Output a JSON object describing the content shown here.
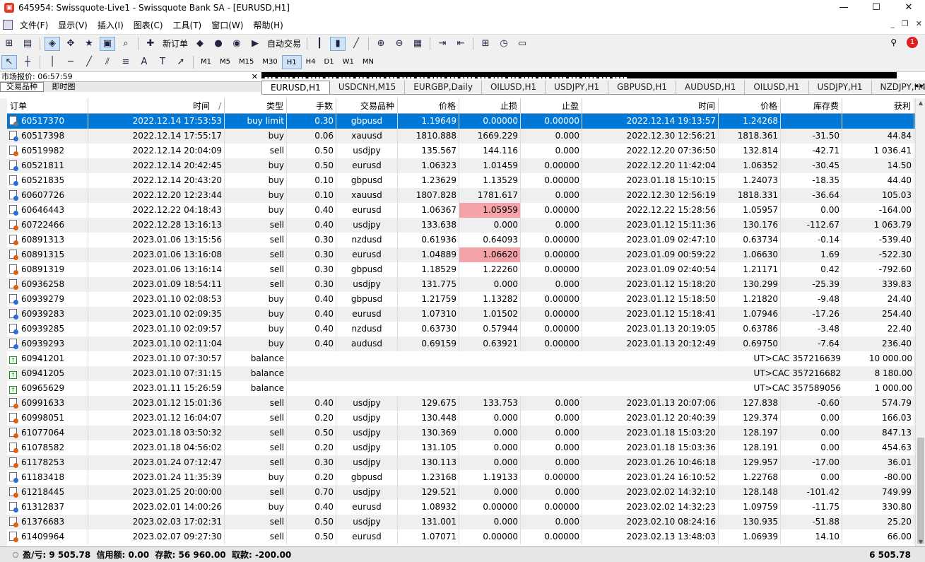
{
  "window": {
    "title": "645954: Swissquote-Live1 - Swissquote Bank SA - [EURUSD,H1]"
  },
  "menu": [
    {
      "label": "文件(F)"
    },
    {
      "label": "显示(V)"
    },
    {
      "label": "插入(I)"
    },
    {
      "label": "图表(C)"
    },
    {
      "label": "工具(T)"
    },
    {
      "label": "窗口(W)"
    },
    {
      "label": "帮助(H)"
    }
  ],
  "toolbar": {
    "new_order": "新订单",
    "auto_trading": "自动交易",
    "notification_count": "1",
    "timeframes": [
      "M1",
      "M5",
      "M15",
      "M30",
      "H1",
      "H4",
      "D1",
      "W1",
      "MN"
    ],
    "selected_timeframe": "H1"
  },
  "market_watch": {
    "title": "市场报价: 06:57:59",
    "tabs": [
      "交易品种",
      "即时图"
    ]
  },
  "chart_tabs": [
    "EURUSD,H1",
    "USDCNH,M15",
    "EURGBP,Daily",
    "OILUSD,H1",
    "USDJPY,H1",
    "GBPUSD,H1",
    "AUDUSD,H1",
    "OILUSD,H1",
    "USDJPY,H1",
    "NZDJPY,H4"
  ],
  "active_chart_tab": "EURUSD,H1",
  "headers": [
    "订单",
    "时间",
    "类型",
    "手数",
    "交易品种",
    "价格",
    "止损",
    "止盈",
    "时间",
    "价格",
    "库存费",
    "获利"
  ],
  "sort_indicator": "/",
  "rows": [
    {
      "ticket": "60517370",
      "open_time": "2022.12.14 17:53:53",
      "type": "buy limit",
      "lots": "0.30",
      "symbol": "gbpusd",
      "open_price": "1.19649",
      "sl": "0.00000",
      "tp": "0.00000",
      "close_time": "2022.12.14 19:13:57",
      "close_price": "1.24268",
      "swap": "",
      "profit": ""
    },
    {
      "ticket": "60517398",
      "open_time": "2022.12.14 17:55:17",
      "type": "buy",
      "lots": "0.06",
      "symbol": "xauusd",
      "open_price": "1810.888",
      "sl": "1669.229",
      "tp": "0.000",
      "close_time": "2022.12.30 12:56:21",
      "close_price": "1818.361",
      "swap": "-31.50",
      "profit": "44.84"
    },
    {
      "ticket": "60519982",
      "open_time": "2022.12.14 20:04:09",
      "type": "sell",
      "lots": "0.50",
      "symbol": "usdjpy",
      "open_price": "135.567",
      "sl": "144.116",
      "tp": "0.000",
      "close_time": "2022.12.20 07:36:50",
      "close_price": "132.814",
      "swap": "-42.71",
      "profit": "1 036.41"
    },
    {
      "ticket": "60521811",
      "open_time": "2022.12.14 20:42:45",
      "type": "buy",
      "lots": "0.50",
      "symbol": "eurusd",
      "open_price": "1.06323",
      "sl": "1.01459",
      "tp": "0.00000",
      "close_time": "2022.12.20 11:42:04",
      "close_price": "1.06352",
      "swap": "-30.45",
      "profit": "14.50"
    },
    {
      "ticket": "60521835",
      "open_time": "2022.12.14 20:43:20",
      "type": "buy",
      "lots": "0.10",
      "symbol": "gbpusd",
      "open_price": "1.23629",
      "sl": "1.13529",
      "tp": "0.00000",
      "close_time": "2023.01.18 15:10:15",
      "close_price": "1.24073",
      "swap": "-18.35",
      "profit": "44.40"
    },
    {
      "ticket": "60607726",
      "open_time": "2022.12.20 12:23:44",
      "type": "buy",
      "lots": "0.10",
      "symbol": "xauusd",
      "open_price": "1807.828",
      "sl": "1781.617",
      "tp": "0.000",
      "close_time": "2022.12.30 12:56:19",
      "close_price": "1818.331",
      "swap": "-36.64",
      "profit": "105.03"
    },
    {
      "ticket": "60646443",
      "open_time": "2022.12.22 04:18:43",
      "type": "buy",
      "lots": "0.40",
      "symbol": "eurusd",
      "open_price": "1.06367",
      "sl": "1.05959",
      "tp": "0.00000",
      "close_time": "2022.12.22 15:28:56",
      "close_price": "1.05957",
      "swap": "0.00",
      "profit": "-164.00",
      "sl_hit": true
    },
    {
      "ticket": "60722466",
      "open_time": "2022.12.28 13:16:13",
      "type": "sell",
      "lots": "0.40",
      "symbol": "usdjpy",
      "open_price": "133.638",
      "sl": "0.000",
      "tp": "0.000",
      "close_time": "2023.01.12 15:11:36",
      "close_price": "130.176",
      "swap": "-112.67",
      "profit": "1 063.79"
    },
    {
      "ticket": "60891313",
      "open_time": "2023.01.06 13:15:56",
      "type": "sell",
      "lots": "0.30",
      "symbol": "nzdusd",
      "open_price": "0.61936",
      "sl": "0.64093",
      "tp": "0.00000",
      "close_time": "2023.01.09 02:47:10",
      "close_price": "0.63734",
      "swap": "-0.14",
      "profit": "-539.40"
    },
    {
      "ticket": "60891315",
      "open_time": "2023.01.06 13:16:08",
      "type": "sell",
      "lots": "0.30",
      "symbol": "eurusd",
      "open_price": "1.04889",
      "sl": "1.06620",
      "tp": "0.00000",
      "close_time": "2023.01.09 00:59:22",
      "close_price": "1.06630",
      "swap": "1.69",
      "profit": "-522.30",
      "sl_hit": true
    },
    {
      "ticket": "60891319",
      "open_time": "2023.01.06 13:16:14",
      "type": "sell",
      "lots": "0.30",
      "symbol": "gbpusd",
      "open_price": "1.18529",
      "sl": "1.22260",
      "tp": "0.00000",
      "close_time": "2023.01.09 02:40:54",
      "close_price": "1.21171",
      "swap": "0.42",
      "profit": "-792.60"
    },
    {
      "ticket": "60936258",
      "open_time": "2023.01.09 18:54:11",
      "type": "sell",
      "lots": "0.30",
      "symbol": "usdjpy",
      "open_price": "131.775",
      "sl": "0.000",
      "tp": "0.000",
      "close_time": "2023.01.12 15:18:20",
      "close_price": "130.299",
      "swap": "-25.39",
      "profit": "339.83"
    },
    {
      "ticket": "60939279",
      "open_time": "2023.01.10 02:08:53",
      "type": "buy",
      "lots": "0.40",
      "symbol": "gbpusd",
      "open_price": "1.21759",
      "sl": "1.13282",
      "tp": "0.00000",
      "close_time": "2023.01.12 15:18:50",
      "close_price": "1.21820",
      "swap": "-9.48",
      "profit": "24.40"
    },
    {
      "ticket": "60939283",
      "open_time": "2023.01.10 02:09:35",
      "type": "buy",
      "lots": "0.40",
      "symbol": "eurusd",
      "open_price": "1.07310",
      "sl": "1.01502",
      "tp": "0.00000",
      "close_time": "2023.01.12 15:18:41",
      "close_price": "1.07946",
      "swap": "-17.26",
      "profit": "254.40"
    },
    {
      "ticket": "60939285",
      "open_time": "2023.01.10 02:09:57",
      "type": "buy",
      "lots": "0.40",
      "symbol": "nzdusd",
      "open_price": "0.63730",
      "sl": "0.57944",
      "tp": "0.00000",
      "close_time": "2023.01.13 20:19:05",
      "close_price": "0.63786",
      "swap": "-3.48",
      "profit": "22.40"
    },
    {
      "ticket": "60939293",
      "open_time": "2023.01.10 02:11:04",
      "type": "buy",
      "lots": "0.40",
      "symbol": "audusd",
      "open_price": "0.69159",
      "sl": "0.63921",
      "tp": "0.00000",
      "close_time": "2023.01.13 20:12:49",
      "close_price": "0.69750",
      "swap": "-7.64",
      "profit": "236.40"
    },
    {
      "ticket": "60941201",
      "open_time": "2023.01.10 07:30:57",
      "type": "balance",
      "comment": "UT>CAC 357216639",
      "profit": "10 000.00"
    },
    {
      "ticket": "60941205",
      "open_time": "2023.01.10 07:31:15",
      "type": "balance",
      "comment": "UT>CAC 357216682",
      "profit": "8 180.00"
    },
    {
      "ticket": "60965629",
      "open_time": "2023.01.11 15:26:59",
      "type": "balance",
      "comment": "UT>CAC 357589056",
      "profit": "1 000.00"
    },
    {
      "ticket": "60991633",
      "open_time": "2023.01.12 15:01:36",
      "type": "sell",
      "lots": "0.40",
      "symbol": "usdjpy",
      "open_price": "129.675",
      "sl": "133.753",
      "tp": "0.000",
      "close_time": "2023.01.13 20:07:06",
      "close_price": "127.838",
      "swap": "-0.60",
      "profit": "574.79"
    },
    {
      "ticket": "60998051",
      "open_time": "2023.01.12 16:04:07",
      "type": "sell",
      "lots": "0.20",
      "symbol": "usdjpy",
      "open_price": "130.448",
      "sl": "0.000",
      "tp": "0.000",
      "close_time": "2023.01.12 20:40:39",
      "close_price": "129.374",
      "swap": "0.00",
      "profit": "166.03"
    },
    {
      "ticket": "61077064",
      "open_time": "2023.01.18 03:50:32",
      "type": "sell",
      "lots": "0.50",
      "symbol": "usdjpy",
      "open_price": "130.369",
      "sl": "0.000",
      "tp": "0.000",
      "close_time": "2023.01.18 15:03:20",
      "close_price": "128.197",
      "swap": "0.00",
      "profit": "847.13"
    },
    {
      "ticket": "61078582",
      "open_time": "2023.01.18 04:56:02",
      "type": "sell",
      "lots": "0.20",
      "symbol": "usdjpy",
      "open_price": "131.105",
      "sl": "0.000",
      "tp": "0.000",
      "close_time": "2023.01.18 15:03:36",
      "close_price": "128.191",
      "swap": "0.00",
      "profit": "454.63"
    },
    {
      "ticket": "61178253",
      "open_time": "2023.01.24 07:12:47",
      "type": "sell",
      "lots": "0.30",
      "symbol": "usdjpy",
      "open_price": "130.113",
      "sl": "0.000",
      "tp": "0.000",
      "close_time": "2023.01.26 10:46:18",
      "close_price": "129.957",
      "swap": "-17.00",
      "profit": "36.01"
    },
    {
      "ticket": "61183418",
      "open_time": "2023.01.24 11:35:39",
      "type": "buy",
      "lots": "0.20",
      "symbol": "gbpusd",
      "open_price": "1.23168",
      "sl": "1.19133",
      "tp": "0.00000",
      "close_time": "2023.01.24 16:10:52",
      "close_price": "1.22768",
      "swap": "0.00",
      "profit": "-80.00"
    },
    {
      "ticket": "61218445",
      "open_time": "2023.01.25 20:00:00",
      "type": "sell",
      "lots": "0.70",
      "symbol": "usdjpy",
      "open_price": "129.521",
      "sl": "0.000",
      "tp": "0.000",
      "close_time": "2023.02.02 14:32:10",
      "close_price": "128.148",
      "swap": "-101.42",
      "profit": "749.99"
    },
    {
      "ticket": "61312837",
      "open_time": "2023.02.01 14:00:26",
      "type": "buy",
      "lots": "0.40",
      "symbol": "eurusd",
      "open_price": "1.08932",
      "sl": "0.00000",
      "tp": "0.00000",
      "close_time": "2023.02.02 14:32:23",
      "close_price": "1.09759",
      "swap": "-11.75",
      "profit": "330.80"
    },
    {
      "ticket": "61376683",
      "open_time": "2023.02.03 17:02:31",
      "type": "sell",
      "lots": "0.50",
      "symbol": "usdjpy",
      "open_price": "131.001",
      "sl": "0.000",
      "tp": "0.000",
      "close_time": "2023.02.10 08:24:16",
      "close_price": "130.935",
      "swap": "-51.88",
      "profit": "25.20"
    },
    {
      "ticket": "61409964",
      "open_time": "2023.02.07 09:27:30",
      "type": "sell",
      "lots": "0.50",
      "symbol": "eurusd",
      "open_price": "1.07071",
      "sl": "0.00000",
      "tp": "0.00000",
      "close_time": "2023.02.13 13:48:03",
      "close_price": "1.06939",
      "swap": "14.10",
      "profit": "66.00"
    }
  ],
  "status_bar": {
    "summary": "盈/亏: 9 505.78  信用额: 0.00  存款: 56 960.00  取款: -200.00",
    "total": "6 505.78"
  }
}
